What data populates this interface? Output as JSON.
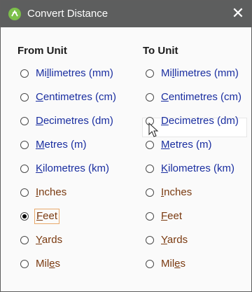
{
  "window": {
    "title": "Convert Distance",
    "close_glyph": "✕",
    "icon": "convert-app-icon"
  },
  "columns": {
    "from_header": "From Unit",
    "to_header": "To Unit"
  },
  "from_options": [
    {
      "pre": "Mi",
      "acc": "l",
      "post": "limetres (mm)",
      "checked": false
    },
    {
      "pre": "",
      "acc": "C",
      "post": "entimetres (cm)",
      "checked": false
    },
    {
      "pre": "",
      "acc": "D",
      "post": "ecimetres (dm)",
      "checked": false
    },
    {
      "pre": "",
      "acc": "M",
      "post": "etres (m)",
      "checked": false
    },
    {
      "pre": "",
      "acc": "K",
      "post": "ilometres (km)",
      "checked": false
    },
    {
      "pre": "",
      "acc": "I",
      "post": "nches",
      "checked": false
    },
    {
      "pre": "",
      "acc": "F",
      "post": "eet",
      "checked": true
    },
    {
      "pre": "",
      "acc": "Y",
      "post": "ards",
      "checked": false
    },
    {
      "pre": "Mil",
      "acc": "e",
      "post": "s",
      "checked": false
    }
  ],
  "to_options": [
    {
      "pre": "Mi",
      "acc": "l",
      "post": "limetres (mm)",
      "checked": false
    },
    {
      "pre": "",
      "acc": "C",
      "post": "entimetres (cm)",
      "checked": false
    },
    {
      "pre": "",
      "acc": "D",
      "post": "ecimetres (dm)",
      "checked": false
    },
    {
      "pre": "",
      "acc": "M",
      "post": "etres (m)",
      "checked": false
    },
    {
      "pre": "",
      "acc": "K",
      "post": "ilometres (km)",
      "checked": false
    },
    {
      "pre": "",
      "acc": "I",
      "post": "nches",
      "checked": false
    },
    {
      "pre": "",
      "acc": "F",
      "post": "eet",
      "checked": false
    },
    {
      "pre": "",
      "acc": "Y",
      "post": "ards",
      "checked": false
    },
    {
      "pre": "Mil",
      "acc": "e",
      "post": "s",
      "checked": false
    }
  ],
  "colors": {
    "titlebar": "#5d5e5e",
    "link_blue": "#1a2ea0",
    "brown": "#7a3a10",
    "icon_green": "#7cc04a"
  }
}
